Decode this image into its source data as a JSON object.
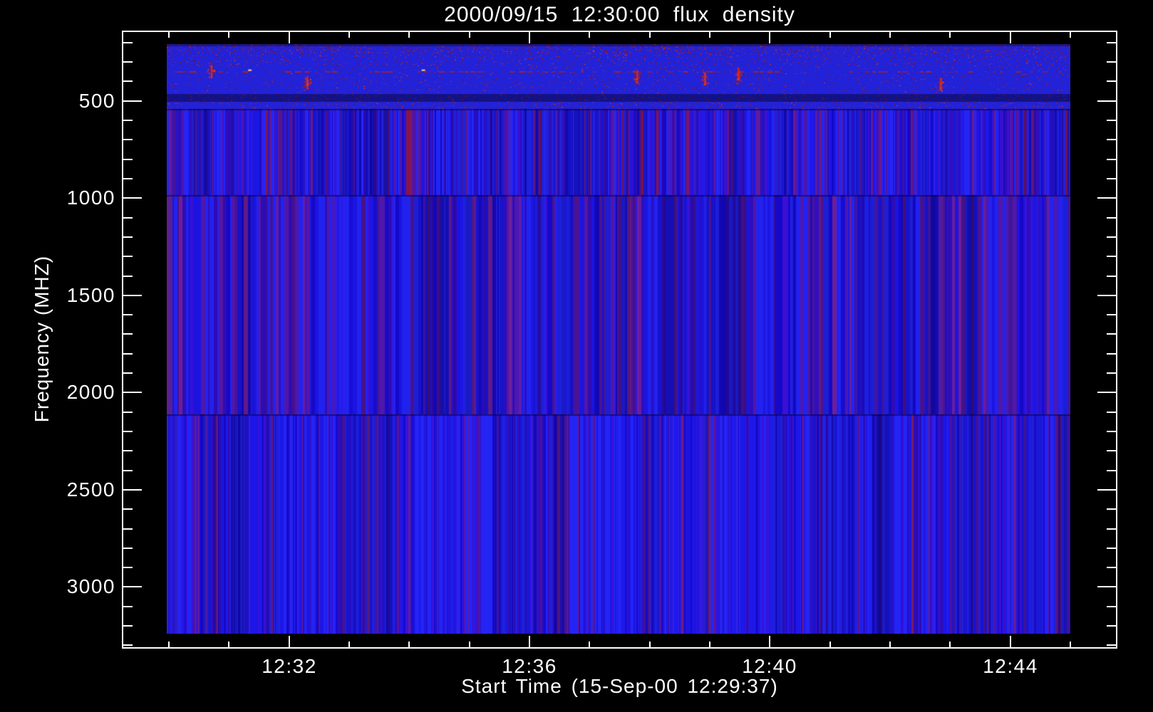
{
  "title": "2000/09/15 12:30:00 flux density",
  "chart_data": {
    "type": "heatmap",
    "subtype": "radio-spectrogram",
    "title": "2000/09/15 12:30:00 flux density",
    "xlabel": "Start Time (15-Sep-00 12:29:37)",
    "ylabel": "Frequency (MHZ)",
    "x_tick_labels": [
      "12:32",
      "12:36",
      "12:40",
      "12:44"
    ],
    "x_minor_step_minutes": 1,
    "x_start": "12:29:58",
    "x_end": "12:45:00",
    "y_major_ticks": [
      500,
      1000,
      1500,
      2000,
      2500,
      3000
    ],
    "y_minor_step_mhz": 100,
    "y_range_mhz": [
      208,
      3240
    ],
    "y_axis_inverted": true,
    "grid": false,
    "legend": "none",
    "colors": {
      "background": "#000000",
      "axes": "#ffffff",
      "base_blue": "#2020dc",
      "stripe_purple": "#5516a2",
      "stripe_dark_blue": "#1508c8",
      "noise_red": "#b41a06",
      "hotspot_red": "#f03808"
    },
    "bands": [
      {
        "name": "low-band-rfi-speckle",
        "freq_mhz": [
          208,
          540
        ],
        "style": "speckle",
        "base": "#2222d8",
        "speckle_colors": [
          "#7c1016",
          "#981408",
          "#b41a06",
          "#d02a08",
          "#e83c0a"
        ]
      },
      {
        "name": "mid-band-1",
        "freq_mhz": [
          540,
          985
        ],
        "style": "stripes",
        "stripe_width": [
          1,
          3
        ],
        "palette": [
          [
            "#2525f2",
            30
          ],
          [
            "#1b16e4",
            22
          ],
          [
            "#1408c6",
            12
          ],
          [
            "#2d0cb2",
            10
          ],
          [
            "#3a10d0",
            10
          ],
          [
            "#55149e",
            8
          ],
          [
            "#6d1a88",
            5
          ],
          [
            "#8c1440",
            3
          ]
        ]
      },
      {
        "name": "mid-band-2",
        "freq_mhz": [
          985,
          2112
        ],
        "style": "stripes",
        "stripe_width": [
          2,
          6
        ],
        "palette": [
          [
            "#2222ee",
            26
          ],
          [
            "#1b14e0",
            20
          ],
          [
            "#1608c8",
            10
          ],
          [
            "#2e0cb4",
            12
          ],
          [
            "#3a10d4",
            7
          ],
          [
            "#5516a2",
            12
          ],
          [
            "#6e1e96",
            7
          ],
          [
            "#47128c",
            6
          ]
        ],
        "left_edge_column": "#5a2090"
      },
      {
        "name": "high-band",
        "freq_mhz": [
          2112,
          3240
        ],
        "style": "stripes",
        "stripe_width": [
          1,
          3
        ],
        "palette": [
          [
            "#2424f4",
            34
          ],
          [
            "#1c16e6",
            24
          ],
          [
            "#1508ca",
            10
          ],
          [
            "#2d0cb6",
            9
          ],
          [
            "#3b10d2",
            10
          ],
          [
            "#53149c",
            7
          ],
          [
            "#701a8a",
            4
          ],
          [
            "#8e1a3c",
            2
          ]
        ]
      }
    ],
    "features": {
      "red_streak_rows_frac": [
        0.046
      ],
      "dark_rows_frac": [
        {
          "y": 0.084,
          "h": 0.013
        }
      ],
      "hotspots_frac": [
        [
          0.049,
          0.046
        ],
        [
          0.155,
          0.064
        ],
        [
          0.52,
          0.055
        ],
        [
          0.595,
          0.058
        ],
        [
          0.632,
          0.05
        ],
        [
          0.856,
          0.067
        ]
      ],
      "bright_marks_frac": [
        [
          0.09,
          0.043
        ],
        [
          0.282,
          0.043
        ]
      ]
    }
  }
}
